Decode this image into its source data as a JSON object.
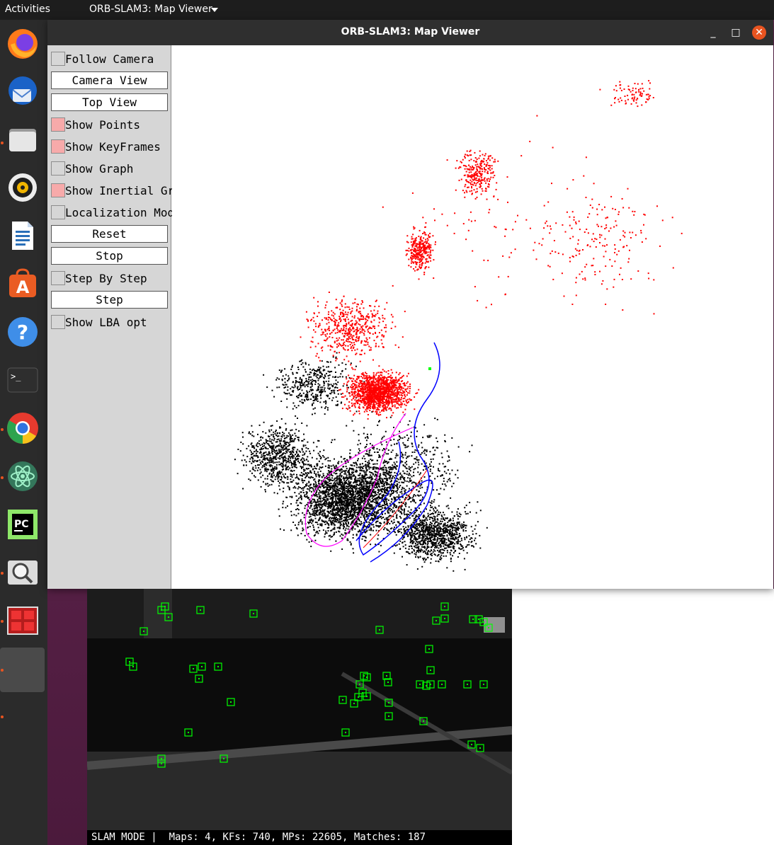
{
  "topbar": {
    "activities_label": "Activities",
    "app_menu_label": "ORB-SLAM3: Map Viewer"
  },
  "dock": {
    "apps": [
      {
        "name": "Firefox",
        "icon": "firefox-icon"
      },
      {
        "name": "Thunderbird",
        "icon": "thunderbird-icon"
      },
      {
        "name": "Files",
        "icon": "files-icon"
      },
      {
        "name": "Rhythmbox",
        "icon": "rhythmbox-icon"
      },
      {
        "name": "LibreOffice Writer",
        "icon": "writer-icon"
      },
      {
        "name": "Ubuntu Software",
        "icon": "software-icon"
      },
      {
        "name": "Help",
        "icon": "help-icon"
      },
      {
        "name": "Terminal",
        "icon": "terminal-icon"
      },
      {
        "name": "Chrome",
        "icon": "chrome-icon"
      },
      {
        "name": "Atom",
        "icon": "atom-icon"
      },
      {
        "name": "PyCharm",
        "icon": "pycharm-icon"
      },
      {
        "name": "Image Viewer",
        "icon": "magnifier-icon"
      },
      {
        "name": "System Monitor",
        "icon": "monitor-icon"
      }
    ],
    "terminal_glyph": ">_",
    "pycharm_glyph": "PC",
    "help_glyph": "?"
  },
  "window": {
    "title": "ORB-SLAM3: Map Viewer",
    "minimize_glyph": "_",
    "maximize_glyph": "□",
    "close_glyph": "✕"
  },
  "panel": {
    "follow_camera": "Follow Camera",
    "camera_view": "Camera View",
    "top_view": "Top View",
    "show_points": "Show Points",
    "show_keyframes": "Show KeyFrames",
    "show_graph": "Show Graph",
    "show_inertial_graph": "Show Inertial Graph",
    "localization_mode": "Localization Mode",
    "reset": "Reset",
    "stop": "Stop",
    "step_by_step": "Step By Step",
    "step": "Step",
    "show_lba_opt": "Show LBA opt"
  },
  "checkbox_states": {
    "follow_camera": false,
    "show_points": true,
    "show_keyframes": true,
    "show_graph": false,
    "show_inertial_graph": true,
    "localization_mode": false,
    "step_by_step": false,
    "show_lba_opt": false
  },
  "colors": {
    "checked": "#f7aaaa",
    "map_point_reference": "#ff0000",
    "map_point": "#000000",
    "keyframe": "#0000ff",
    "inertial_graph": "#ff00ff",
    "current_camera": "#00ff00",
    "feature_box": "#00ff00"
  },
  "status": {
    "text": "SLAM MODE |  Maps: 4, KFs: 740, MPs: 22605, Matches: 187"
  }
}
